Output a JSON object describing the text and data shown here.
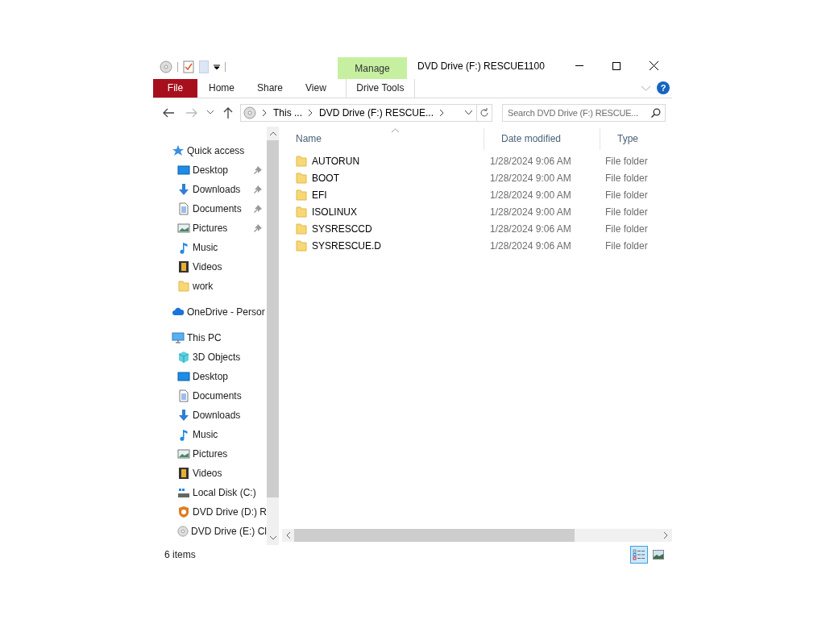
{
  "window": {
    "title": "DVD Drive (F:) RESCUE1100",
    "context_label": "Manage",
    "help": "?"
  },
  "ribbon_tabs": [
    {
      "label": "File",
      "kind": "file"
    },
    {
      "label": "Home",
      "kind": "plain"
    },
    {
      "label": "Share",
      "kind": "plain"
    },
    {
      "label": "View",
      "kind": "plain"
    },
    {
      "label": "Drive Tools",
      "kind": "context"
    }
  ],
  "address": {
    "crumbs": [
      "This ...",
      "DVD Drive (F:) RESCUE..."
    ]
  },
  "search": {
    "placeholder": "Search DVD Drive (F:) RESCUE..."
  },
  "nav": [
    {
      "label": "Quick access",
      "kind": "star",
      "children": [
        {
          "label": "Desktop",
          "kind": "desktop",
          "pinned": true
        },
        {
          "label": "Downloads",
          "kind": "download",
          "pinned": true
        },
        {
          "label": "Documents",
          "kind": "document",
          "pinned": true
        },
        {
          "label": "Pictures",
          "kind": "picture",
          "pinned": true
        },
        {
          "label": "Music",
          "kind": "music",
          "pinned": false
        },
        {
          "label": "Videos",
          "kind": "video",
          "pinned": false
        },
        {
          "label": "work",
          "kind": "folder",
          "pinned": false
        }
      ]
    },
    {
      "label": "OneDrive - Persor",
      "kind": "cloud"
    },
    {
      "label": "This PC",
      "kind": "pc",
      "children": [
        {
          "label": "3D Objects",
          "kind": "cube",
          "pinned": false
        },
        {
          "label": "Desktop",
          "kind": "desktop",
          "pinned": false
        },
        {
          "label": "Documents",
          "kind": "document",
          "pinned": false
        },
        {
          "label": "Downloads",
          "kind": "download",
          "pinned": false
        },
        {
          "label": "Music",
          "kind": "music",
          "pinned": false
        },
        {
          "label": "Pictures",
          "kind": "picture",
          "pinned": false
        },
        {
          "label": "Videos",
          "kind": "video",
          "pinned": false
        },
        {
          "label": "Local Disk (C:)",
          "kind": "disk",
          "pinned": false
        },
        {
          "label": "DVD Drive (D:) R",
          "kind": "dvd-badge",
          "pinned": false
        },
        {
          "label": "DVD Drive (E:) Cl",
          "kind": "disc",
          "pinned": false
        }
      ]
    }
  ],
  "columns": [
    {
      "label": "Name",
      "sorted": true
    },
    {
      "label": "Date modified",
      "sorted": false
    },
    {
      "label": "Type",
      "sorted": false
    }
  ],
  "rows": [
    {
      "name": "AUTORUN",
      "date": "1/28/2024 9:06 AM",
      "type": "File folder"
    },
    {
      "name": "BOOT",
      "date": "1/28/2024 9:00 AM",
      "type": "File folder"
    },
    {
      "name": "EFI",
      "date": "1/28/2024 9:00 AM",
      "type": "File folder"
    },
    {
      "name": "ISOLINUX",
      "date": "1/28/2024 9:00 AM",
      "type": "File folder"
    },
    {
      "name": "SYSRESCCD",
      "date": "1/28/2024 9:06 AM",
      "type": "File folder"
    },
    {
      "name": "SYSRESCUE.D",
      "date": "1/28/2024 9:06 AM",
      "type": "File folder"
    }
  ],
  "status_bar": {
    "count": "6 items",
    "views": [
      {
        "kind": "details",
        "selected": true
      },
      {
        "kind": "large-icons",
        "selected": false
      }
    ]
  }
}
